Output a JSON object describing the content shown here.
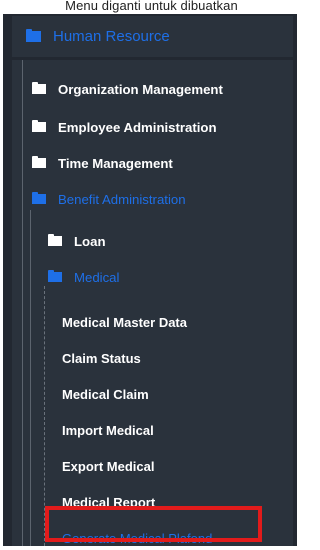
{
  "caption": "Menu diganti untuk dibuatkan",
  "sidebar": {
    "header": {
      "label": "Human Resource",
      "icon": "folder-icon"
    },
    "items": [
      {
        "label": "Organization Management",
        "icon": "folder-icon"
      },
      {
        "label": "Employee Administration",
        "icon": "folder-icon"
      },
      {
        "label": "Time Management",
        "icon": "folder-icon"
      },
      {
        "label": "Benefit Administration",
        "icon": "folder-open-icon",
        "active": true
      }
    ],
    "benefit_children": [
      {
        "label": "Loan",
        "icon": "folder-icon"
      },
      {
        "label": "Medical",
        "icon": "folder-open-icon",
        "active": true
      }
    ],
    "medical_children": [
      {
        "label": "Medical Master Data"
      },
      {
        "label": "Claim Status"
      },
      {
        "label": "Medical Claim"
      },
      {
        "label": "Import Medical"
      },
      {
        "label": "Export Medical"
      },
      {
        "label": "Medical Report"
      },
      {
        "label": "Generate Medical Plafond",
        "active": true
      }
    ]
  },
  "colors": {
    "accent": "#1e6fe7",
    "text": "#ffffff",
    "highlight": "#e21b1b",
    "panel": "#222831"
  }
}
